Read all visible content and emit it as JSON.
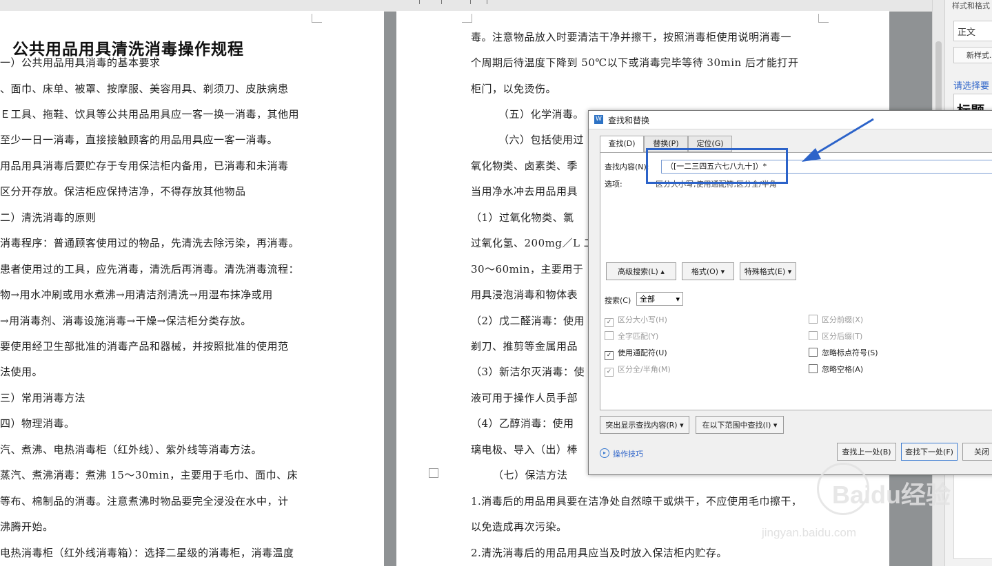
{
  "left_page": {
    "title": "公共用品用具清洗消毒操作规程",
    "lines": [
      "一）公共用品用具消毒的基本要求",
      "、面巾、床单、被罩、按摩服、美容用具、剃须刀、皮肤病患",
      "Ｅ工具、拖鞋、饮具等公共用品用具应一客一换一消毒，其他用",
      "至少一日一消毒，直接接触顾客的用品用具应一客一消毒。",
      "用品用具消毒后要贮存于专用保洁柜内备用，已消毒和未消毒",
      "区分开存放。保洁柜应保持洁净，不得存放其他物品",
      "二）清洗消毒的原则",
      "消毒程序：普通顾客使用过的物品，先清洗去除污染，再消毒。",
      "患者使用过的工具，应先消毒，清洗后再消毒。清洗消毒流程：",
      "物→用水冲刷或用水煮沸→用清洁剂清洗→用湿布抹净或用",
      "→用消毒剂、消毒设施消毒→干燥→保洁柜分类存放。",
      "要使用经卫生部批准的消毒产品和器械，并按照批准的使用范",
      "法使用。",
      "三）常用消毒方法",
      "四）物理消毒。",
      "汽、煮沸、电热消毒柜（红外线）、紫外线等消毒方法。",
      "蒸汽、煮沸消毒：煮沸 15～30min，主要用于毛巾、面巾、床",
      "等布、棉制品的消毒。注意煮沸时物品要完全浸没在水中，计",
      "沸腾开始。",
      "电热消毒柜（红外线消毒箱）：选择二星级的消毒柜，消毒温度"
    ]
  },
  "right_page": {
    "lines": [
      "毒。注意物品放入时要清洁干净并擦干，按照消毒柜使用说明消毒一",
      "个周期后待温度下降到 50℃以下或消毒完毕等待 30min 后才能打开",
      "柜门，以免烫伤。",
      "（五）化学消毒。",
      "（六）包括使用过",
      "氧化物类、卤素类、季",
      "当用净水冲去用品用具",
      "（1）过氧化物类、氯",
      "过氧化氢、200mg／L 二",
      "30～60min，主要用于",
      "用具浸泡消毒和物体表",
      "（2）戊二醛消毒：使用",
      "剃刀、推剪等金属用品",
      "（3）新洁尔灭消毒：使",
      "液可用于操作人员手部",
      "（4）乙醇消毒：使用",
      "璃电极、导入（出）棒",
      "（七）保洁方法",
      "1.消毒后的用品用具要在洁净处自然晾干或烘干，不应使用毛巾擦干，",
      "以免造成再次污染。",
      "2.清洗消毒后的用品用具应当及时放入保洁柜内贮存。"
    ]
  },
  "right_panel": {
    "header": "样式和格式",
    "style_value": "正文",
    "new_style": "新样式...",
    "pick_label": "请选择要",
    "heading_sample": "标题"
  },
  "dialog": {
    "title": "查找和替换",
    "tabs": [
      "查找(D)",
      "替换(P)",
      "定位(G)"
    ],
    "find_label": "查找内容(N):",
    "find_value": "（[一二三四五六七八九十]）*",
    "options_label": "选项:",
    "options_value": "区分大小写,使用通配符,区分全/半角",
    "advanced_btn": "高级搜索(L) ▴",
    "format_btn": "格式(O)",
    "special_btn": "特殊格式(E)",
    "search_label": "搜索(C)",
    "search_value": "全部",
    "checkboxes_left": [
      {
        "label": "区分大小写(H)",
        "checked": true,
        "enabled": false
      },
      {
        "label": "全字匹配(Y)",
        "checked": false,
        "enabled": false
      },
      {
        "label": "使用通配符(U)",
        "checked": true,
        "enabled": true
      },
      {
        "label": "区分全/半角(M)",
        "checked": true,
        "enabled": false
      }
    ],
    "checkboxes_right": [
      {
        "label": "区分前缀(X)",
        "checked": false,
        "enabled": false
      },
      {
        "label": "区分后缀(T)",
        "checked": false,
        "enabled": false
      },
      {
        "label": "忽略标点符号(S)",
        "checked": false,
        "enabled": true
      },
      {
        "label": "忽略空格(A)",
        "checked": false,
        "enabled": true
      }
    ],
    "highlight_btn": "突出显示查找内容(R)",
    "range_btn": "在以下范围中查找(I)",
    "tips_link": "操作技巧",
    "find_prev_btn": "查找上一处(B)",
    "find_next_btn": "查找下一处(F)",
    "close_btn": "关闭"
  },
  "watermark": {
    "brand": "Baidu经验",
    "url": "jingyan.baidu.com"
  }
}
